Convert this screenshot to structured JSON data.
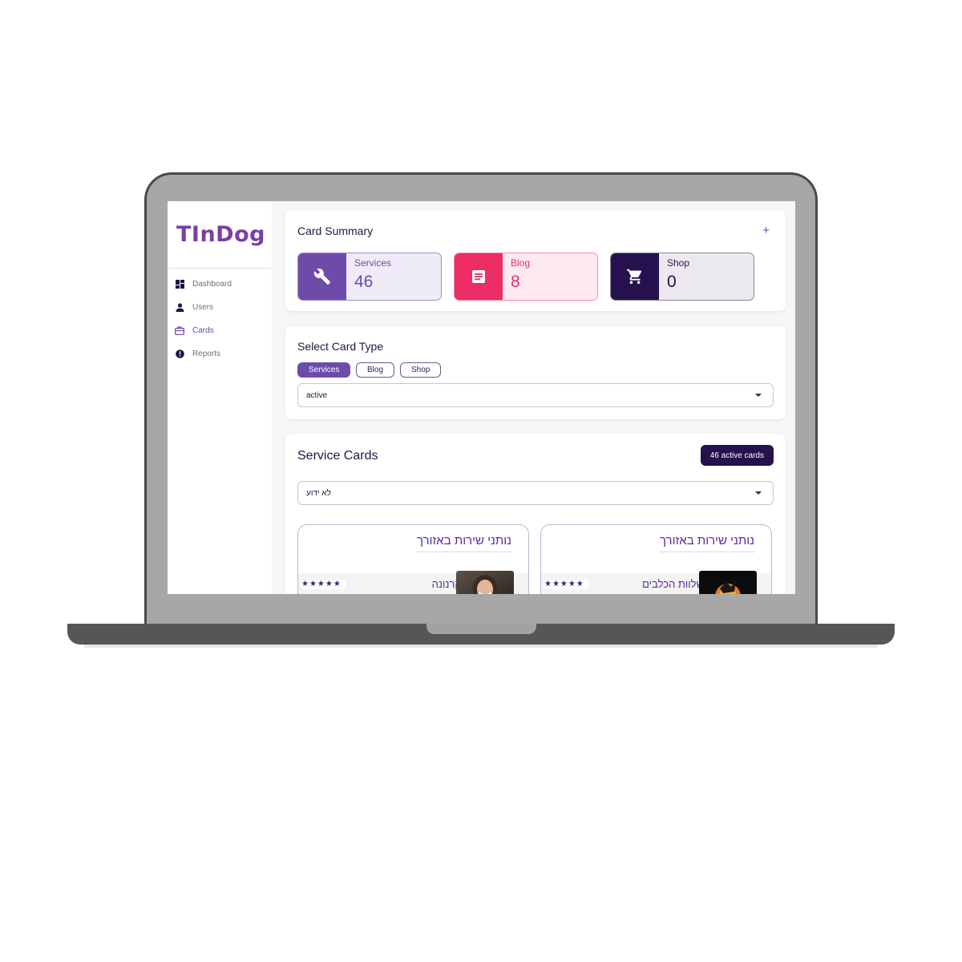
{
  "brand": {
    "logo": "TInDog"
  },
  "sidebar": {
    "items": [
      {
        "label": "Dashboard",
        "icon": "dashboard-icon"
      },
      {
        "label": "Users",
        "icon": "user-icon"
      },
      {
        "label": "Cards",
        "icon": "cards-icon",
        "active": true
      },
      {
        "label": "Reports",
        "icon": "alert-icon"
      }
    ]
  },
  "summary": {
    "title": "Card Summary",
    "add_label": "+",
    "stats": [
      {
        "label": "Services",
        "value": "46",
        "icon": "wrench-icon",
        "color": "#6f4ba9"
      },
      {
        "label": "Blog",
        "value": "8",
        "icon": "article-icon",
        "color": "#ec2d66"
      },
      {
        "label": "Shop",
        "value": "0",
        "icon": "cart-icon",
        "color": "#24114d"
      }
    ]
  },
  "card_type": {
    "title": "Select Card Type",
    "chips": [
      "Services",
      "Blog",
      "Shop"
    ],
    "selected_chip": "Services",
    "status_select": "active"
  },
  "service_cards": {
    "title": "Service Cards",
    "badge": "46 active cards",
    "filter_select": "לא ידוע",
    "cards": [
      {
        "heading": "נותני שירות באזורך",
        "name": "קרנונה",
        "stars": "★★★★★"
      },
      {
        "heading": "נותני שירות באזורך",
        "name": "שלוות הכלבים",
        "stars": "★★★★★"
      }
    ]
  },
  "colors": {
    "accent": "#6f4ba9",
    "pink": "#ec2d66",
    "navy": "#24114d"
  }
}
